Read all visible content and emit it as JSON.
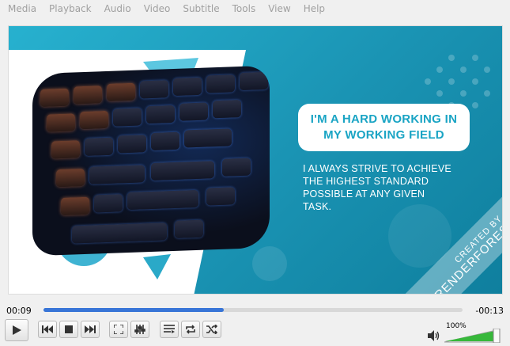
{
  "menu": {
    "items": [
      {
        "label": "Media"
      },
      {
        "label": "Playback"
      },
      {
        "label": "Audio"
      },
      {
        "label": "Video"
      },
      {
        "label": "Subtitle"
      },
      {
        "label": "Tools"
      },
      {
        "label": "View"
      },
      {
        "label": "Help"
      }
    ]
  },
  "video": {
    "title_line1": "I'M A HARD WORKING IN",
    "title_line2": "MY WORKING FIELD",
    "body": "I ALWAYS STRIVE TO ACHIEVE THE HIGHEST STANDARD POSSIBLE AT ANY GIVEN TASK.",
    "watermark_small": "CREATED BY",
    "watermark_big": "RENDERFOREST.COM"
  },
  "playback": {
    "elapsed": "00:09",
    "remaining": "-00:13",
    "progress": 0.43
  },
  "volume": {
    "label": "100%",
    "level": 1.0
  },
  "buttons": {
    "play": "play-icon",
    "previous": "previous-icon",
    "stop": "stop-icon",
    "next": "next-icon",
    "fullscreen": "fullscreen-icon",
    "extended": "equalizer-icon",
    "playlist": "playlist-icon",
    "loop": "loop-icon",
    "shuffle": "shuffle-icon"
  },
  "colors": {
    "video_bg": "#27b1cf",
    "accent_text": "#19a4c4",
    "seek_fill": "#3875d7",
    "volume_fill": "#37b83b"
  }
}
